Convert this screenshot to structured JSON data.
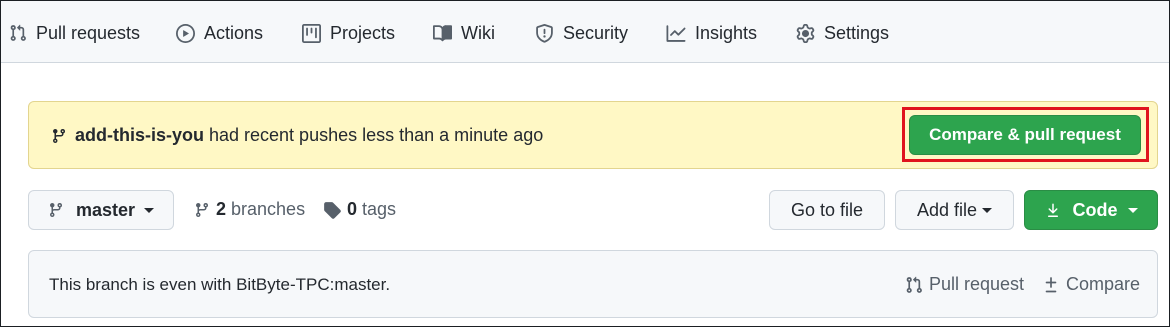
{
  "nav": {
    "items": [
      {
        "label": "Pull requests",
        "icon": "pull-request-icon"
      },
      {
        "label": "Actions",
        "icon": "play-icon"
      },
      {
        "label": "Projects",
        "icon": "project-icon"
      },
      {
        "label": "Wiki",
        "icon": "book-icon"
      },
      {
        "label": "Security",
        "icon": "shield-icon"
      },
      {
        "label": "Insights",
        "icon": "graph-icon"
      },
      {
        "label": "Settings",
        "icon": "gear-icon"
      }
    ]
  },
  "banner": {
    "branch_name": "add-this-is-you",
    "message": "had recent pushes less than a minute ago",
    "button_label": "Compare & pull request"
  },
  "toolbar": {
    "branch": "master",
    "branches_count": "2",
    "branches_label": "branches",
    "tags_count": "0",
    "tags_label": "tags",
    "goto_file": "Go to file",
    "add_file": "Add file",
    "code": "Code"
  },
  "status": {
    "text": "This branch is even with BitByte-TPC:master.",
    "pull_request": "Pull request",
    "compare": "Compare"
  },
  "colors": {
    "primary_green": "#2da44e",
    "banner_yellow": "#fff8c5",
    "highlight_red": "#e0141e"
  }
}
